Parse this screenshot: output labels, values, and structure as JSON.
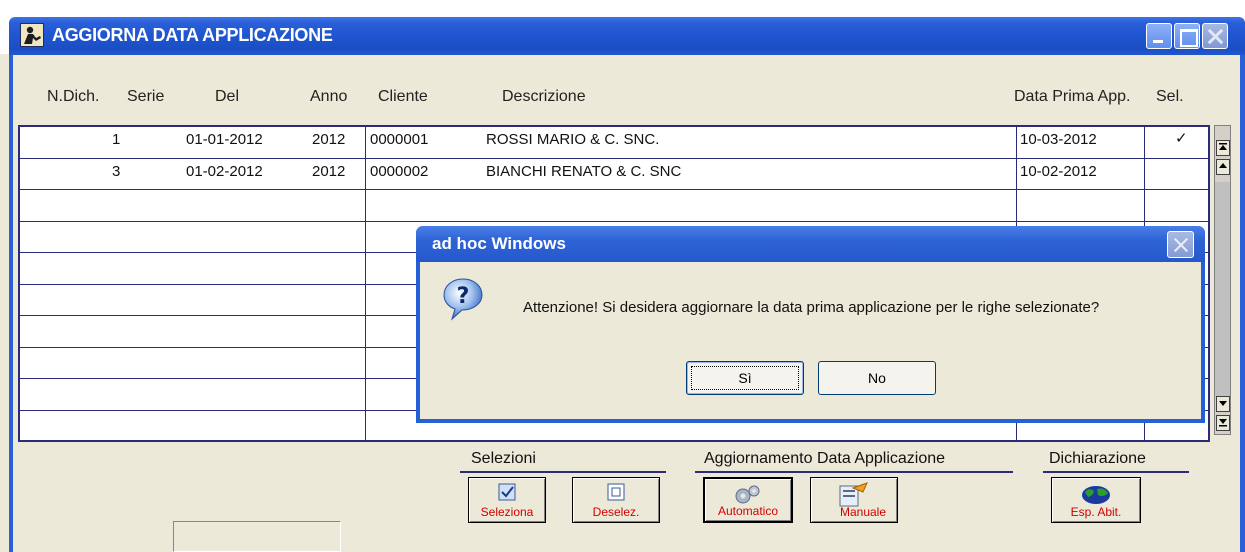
{
  "window": {
    "title": "AGGIORNA DATA APPLICAZIONE"
  },
  "columns": {
    "ndich": "N.Dich.",
    "serie": "Serie",
    "del": "Del",
    "anno": "Anno",
    "cliente": "Cliente",
    "descrizione": "Descrizione",
    "data_prima": "Data Prima App.",
    "sel": "Sel."
  },
  "rows": [
    {
      "ndich": "1",
      "serie": "",
      "del": "01-01-2012",
      "anno": "2012",
      "cliente": "0000001",
      "descrizione": "ROSSI MARIO & C. SNC.",
      "data_prima": "10-03-2012",
      "sel": "✓"
    },
    {
      "ndich": "3",
      "serie": "",
      "del": "01-02-2012",
      "anno": "2012",
      "cliente": "0000002",
      "descrizione": "BIANCHI RENATO & C. SNC",
      "data_prima": "10-02-2012",
      "sel": ""
    }
  ],
  "groups": {
    "selezioni": "Selezioni",
    "aggiornamento": "Aggiornamento Data Applicazione",
    "dichiarazione": "Dichiarazione"
  },
  "buttons": {
    "seleziona": "Seleziona",
    "deselez": "Deselez.",
    "automatico": "Automatico",
    "manuale": "Manuale",
    "esp_abit": "Esp. Abit."
  },
  "dialog": {
    "title": "ad hoc Windows",
    "message": "Attenzione! Si desidera aggiornare la data prima applicazione per le righe selezionate?",
    "yes_label": "Sì",
    "no_label": "No"
  },
  "colors": {
    "titlebar": "#2a5fd8",
    "grid_border": "#2b2b7a",
    "button_label": "#d40000",
    "face": "#ece9d8"
  },
  "icons": {
    "app": "person-icon",
    "dialog": "question-icon"
  }
}
